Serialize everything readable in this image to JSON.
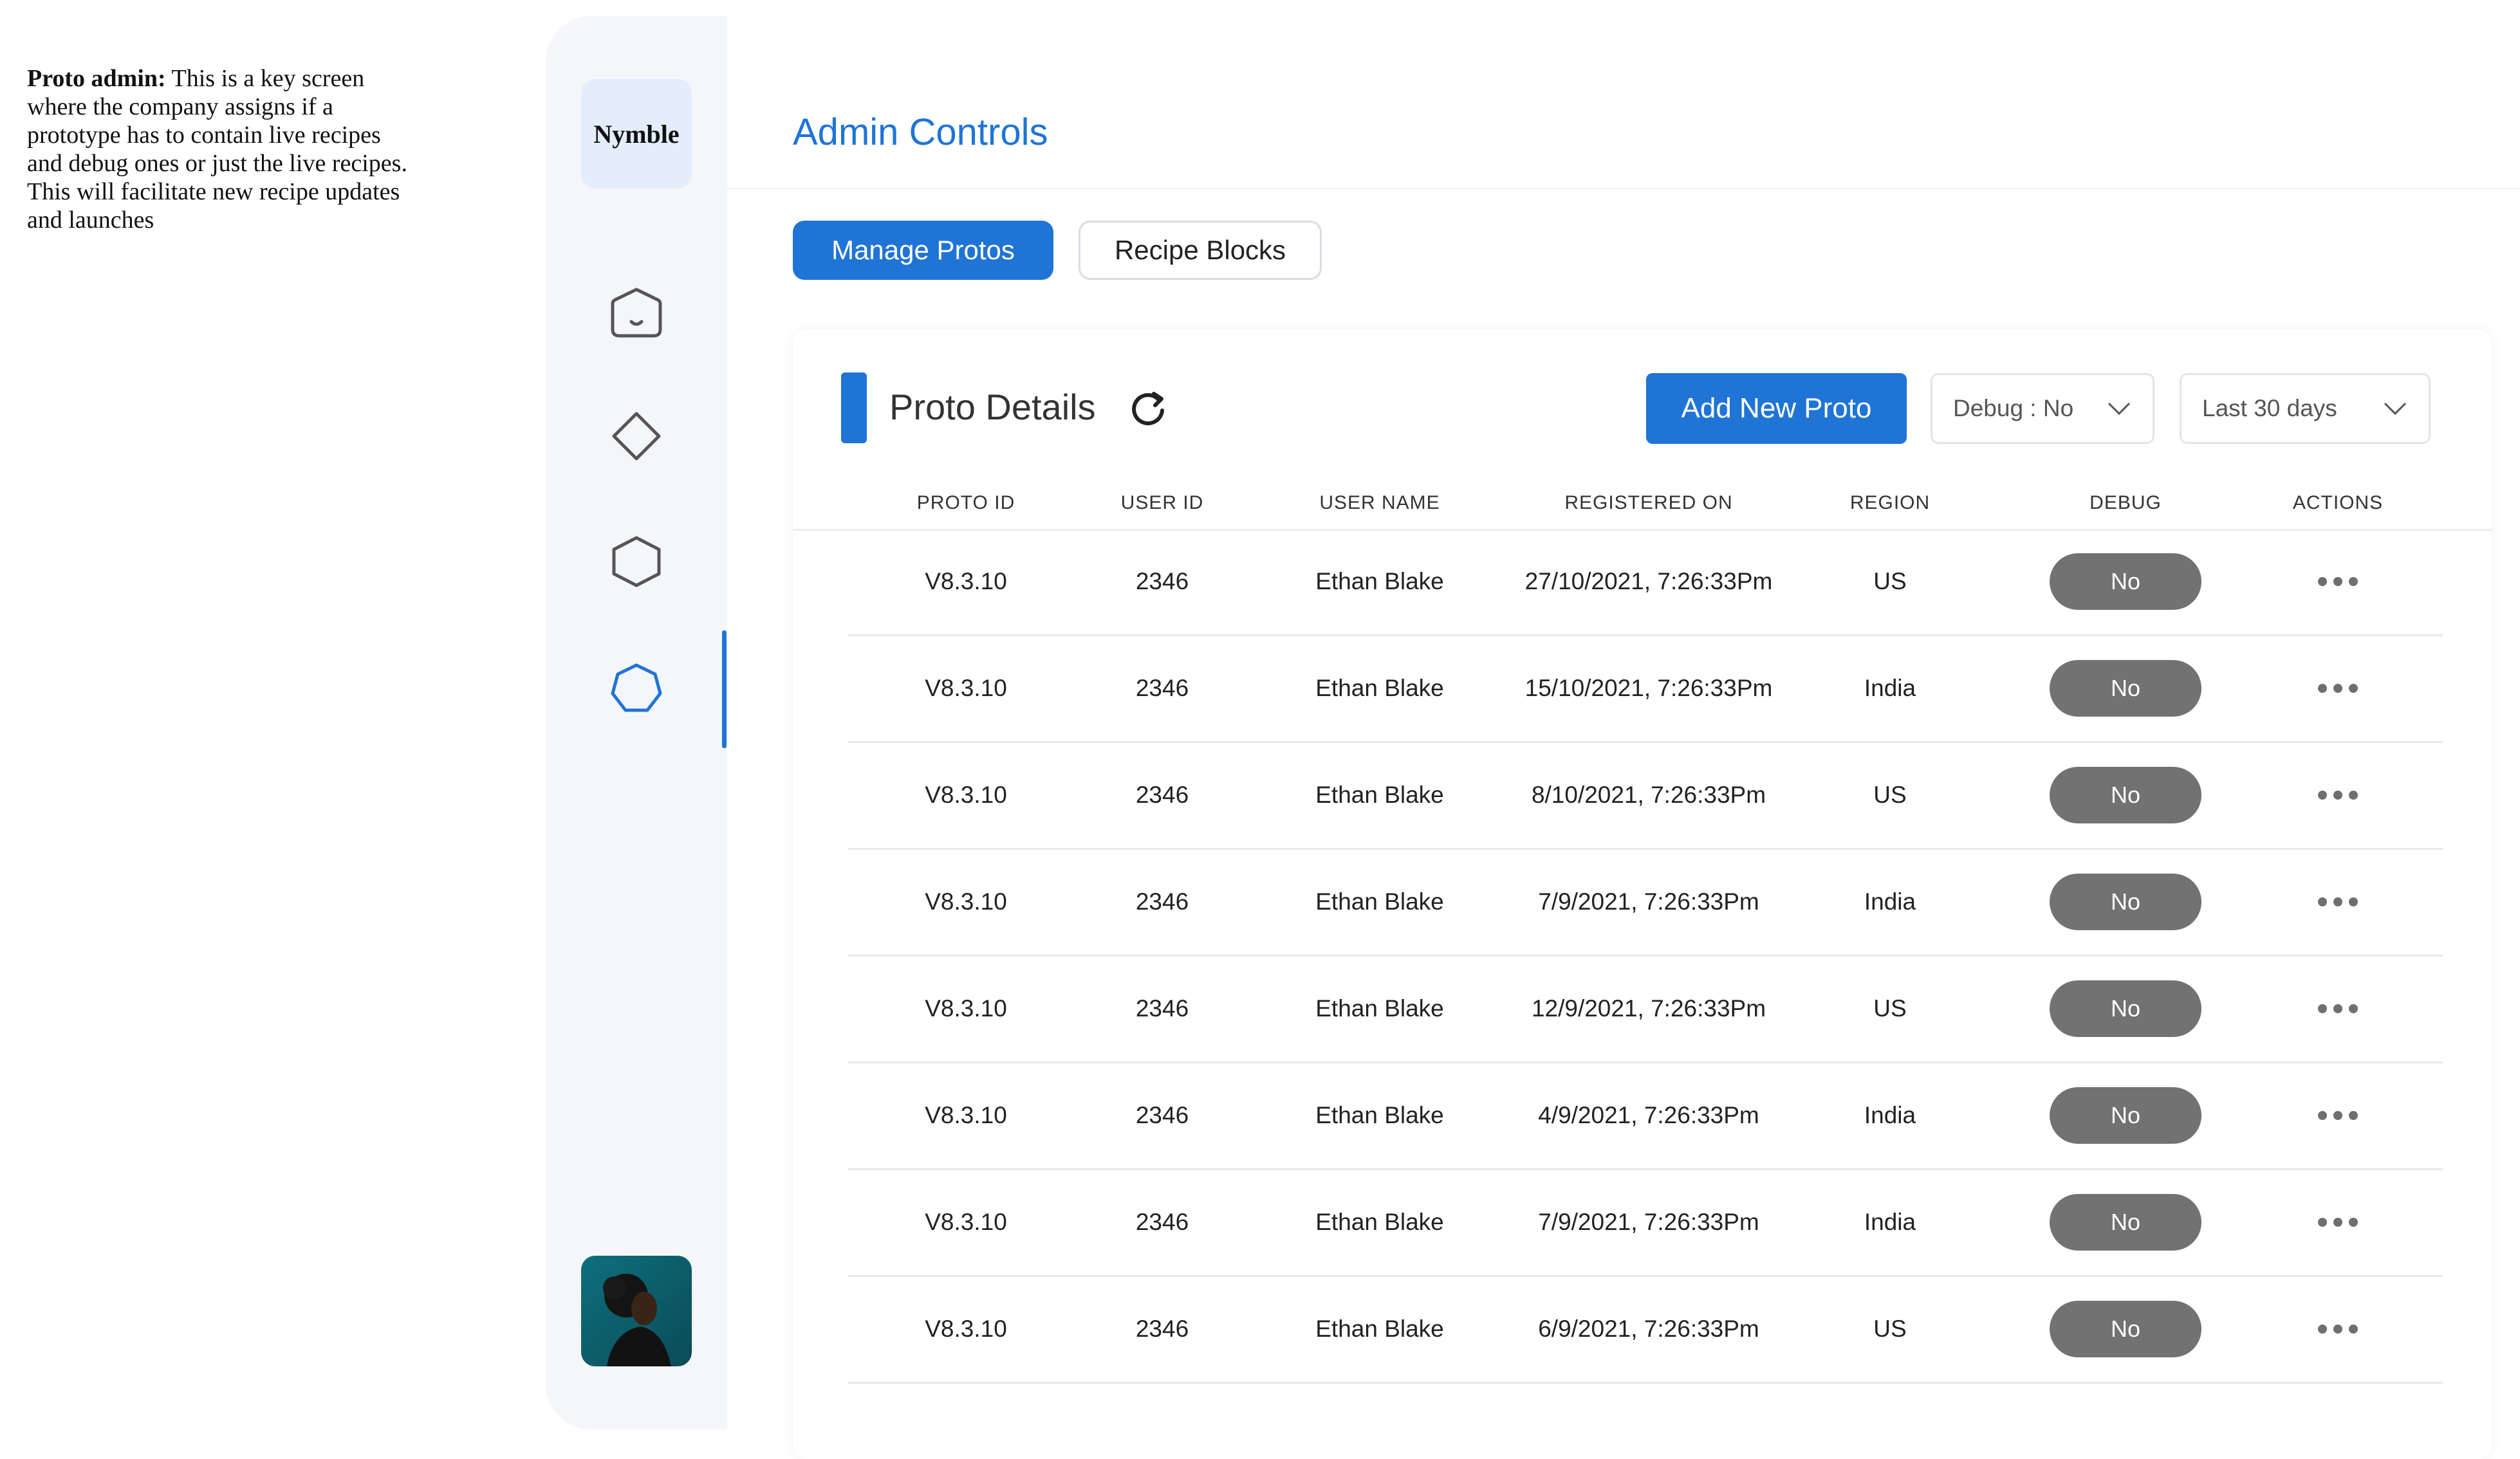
{
  "annotation": {
    "bold_label": "Proto admin:",
    "text": "This is a key screen where the company assigns if a prototype has to contain live recipes and debug ones or just the live recipes. This will facilitate new recipe updates and launches"
  },
  "sidebar": {
    "logo": "Nymble",
    "icons": [
      "rounded-hexagon-smile-icon",
      "diamond-icon",
      "hexagon-icon",
      "heptagon-icon"
    ],
    "active_index": 3
  },
  "header": {
    "title": "Admin Controls"
  },
  "tabs": [
    {
      "label": "Manage Protos",
      "active": true
    },
    {
      "label": "Recipe Blocks",
      "active": false
    }
  ],
  "card": {
    "title": "Proto Details",
    "add_button": "Add New Proto",
    "debug_filter": "Debug : No",
    "range_filter": "Last 30 days"
  },
  "table": {
    "columns": [
      "PROTO ID",
      "USER ID",
      "USER NAME",
      "REGISTERED ON",
      "REGION",
      "DEBUG",
      "ACTIONS"
    ],
    "rows": [
      {
        "proto_id": "V8.3.10",
        "user_id": "2346",
        "user_name": "Ethan Blake",
        "registered_on": "27/10/2021, 7:26:33Pm",
        "region": "US",
        "debug": "No"
      },
      {
        "proto_id": "V8.3.10",
        "user_id": "2346",
        "user_name": "Ethan Blake",
        "registered_on": "15/10/2021, 7:26:33Pm",
        "region": "India",
        "debug": "No"
      },
      {
        "proto_id": "V8.3.10",
        "user_id": "2346",
        "user_name": "Ethan Blake",
        "registered_on": "8/10/2021, 7:26:33Pm",
        "region": "US",
        "debug": "No"
      },
      {
        "proto_id": "V8.3.10",
        "user_id": "2346",
        "user_name": "Ethan Blake",
        "registered_on": "7/9/2021, 7:26:33Pm",
        "region": "India",
        "debug": "No"
      },
      {
        "proto_id": "V8.3.10",
        "user_id": "2346",
        "user_name": "Ethan Blake",
        "registered_on": "12/9/2021, 7:26:33Pm",
        "region": "US",
        "debug": "No"
      },
      {
        "proto_id": "V8.3.10",
        "user_id": "2346",
        "user_name": "Ethan Blake",
        "registered_on": "4/9/2021, 7:26:33Pm",
        "region": "India",
        "debug": "No"
      },
      {
        "proto_id": "V8.3.10",
        "user_id": "2346",
        "user_name": "Ethan Blake",
        "registered_on": "7/9/2021, 7:26:33Pm",
        "region": "India",
        "debug": "No"
      },
      {
        "proto_id": "V8.3.10",
        "user_id": "2346",
        "user_name": "Ethan Blake",
        "registered_on": "6/9/2021, 7:26:33Pm",
        "region": "US",
        "debug": "No"
      }
    ]
  },
  "colors": {
    "accent": "#1f74d6",
    "pill": "#727272",
    "sidebar_bg": "#f4f6f9"
  }
}
